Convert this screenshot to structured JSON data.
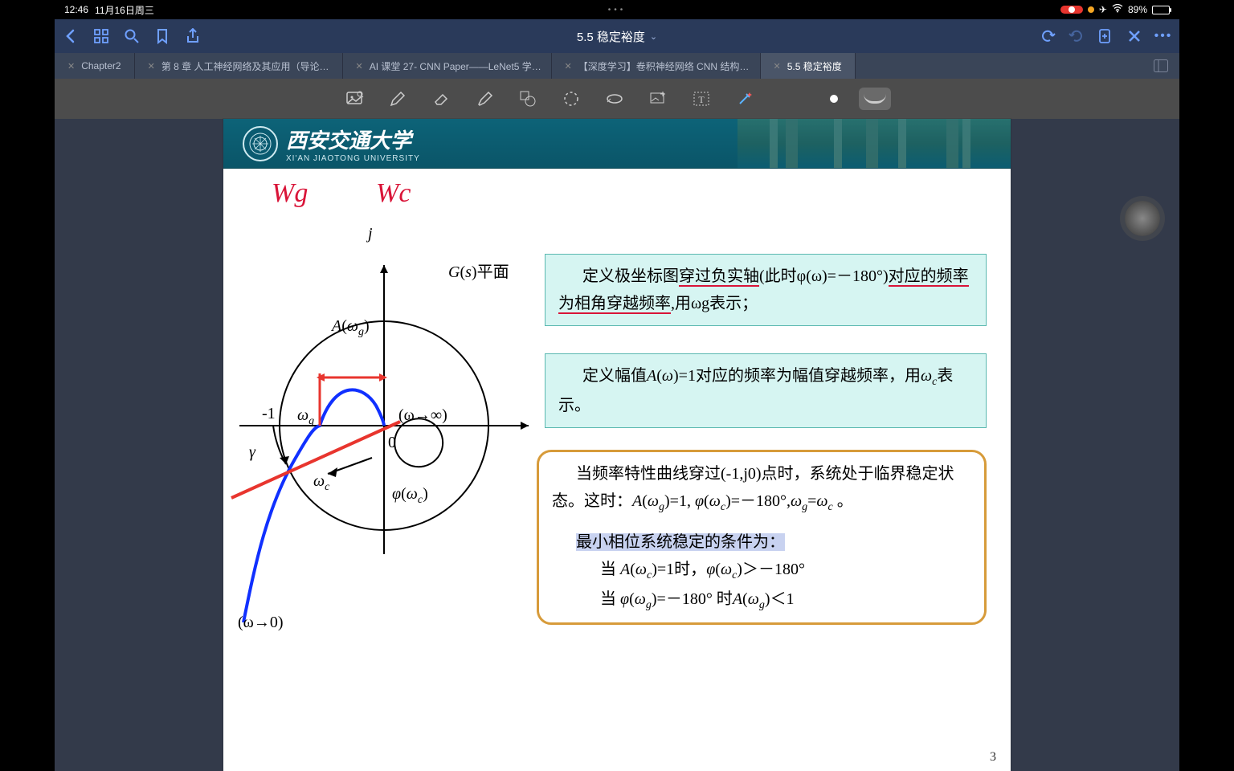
{
  "status": {
    "time": "12:46",
    "date": "11月16日周三",
    "battery_pct": "89%",
    "airplane": "✈︎",
    "wifi": "📶"
  },
  "nav": {
    "title": "5.5 稳定裕度",
    "chevron": "⌄"
  },
  "tabs": [
    {
      "label": "Chapter2"
    },
    {
      "label": "第 8 章 人工神经网络及其应用（导论…"
    },
    {
      "label": "AI 课堂 27- CNN Paper——LeNet5 学…"
    },
    {
      "label": "【深度学习】卷积神经网络 CNN 结构…"
    },
    {
      "label": "5.5 稳定裕度",
      "active": true
    }
  ],
  "uni": {
    "cn": "西安交通大学",
    "en": "XI'AN JIAOTONG UNIVERSITY"
  },
  "hand": {
    "wg": "Wg",
    "wc": "Wc"
  },
  "plot": {
    "j": "j",
    "gs": "G(s)平面",
    "Awg": "A(ωg)",
    "neg1": "-1",
    "wg": "ωg",
    "winf": "(ω→∞)",
    "zero": "0",
    "gamma": "γ",
    "wc": "ωc",
    "phiwc": "φ(ωc)",
    "w0": "(ω→0)"
  },
  "box1": "定义极坐标图穿过负实轴(此时φ(ω)=－180°)对应的频率为相角穿越频率,用ωg表示；",
  "box1_a": "定义极坐标图",
  "box1_b": "穿过负实轴",
  "box1_c": "(此时φ(ω)=－180°)",
  "box1_d": "对应的频率为相角穿越频率",
  "box1_e": ",用ωg表示；",
  "box2": "定义幅值A(ω)=1对应的频率为幅值穿越频率，用ωc表示。",
  "box3_p1": "当频率特性曲线穿过(-1,j0)点时，系统处于临界稳定状态。这时：A(ωg)=1, φ(ωc)=－180°,ωg=ωc 。",
  "box3_h": "最小相位系统稳定的条件为：",
  "box3_c1": "当 A(ωc)=1时，φ(ωc)＞－180°",
  "box3_c2": "当 φ(ωg)=－180° 时A(ωg)＜1",
  "pagenum": "3"
}
